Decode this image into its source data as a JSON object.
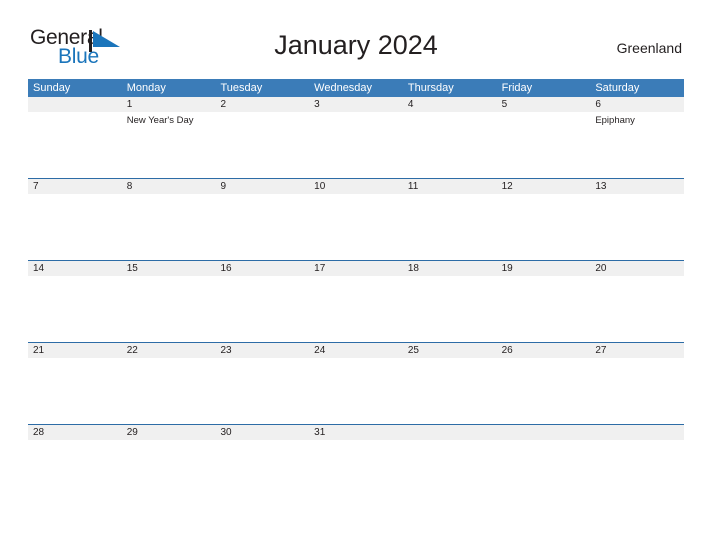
{
  "brand": {
    "name_part1": "General",
    "name_part2": "Blue",
    "mark_color": "#1b75bb",
    "text_color": "#231f20"
  },
  "header": {
    "title": "January 2024",
    "location": "Greenland"
  },
  "colors": {
    "header_blue": "#3b7cb8",
    "week_divider_blue": "#2d6ca6",
    "date_band_gray": "#f0f0f0",
    "text": "#231f20",
    "header_text": "#ffffff"
  },
  "calendar": {
    "month": "January",
    "year": "2024",
    "weekday_headers": [
      "Sunday",
      "Monday",
      "Tuesday",
      "Wednesday",
      "Thursday",
      "Friday",
      "Saturday"
    ],
    "weeks": [
      {
        "days": [
          {
            "date": "",
            "events": []
          },
          {
            "date": "1",
            "events": [
              "New Year's Day"
            ]
          },
          {
            "date": "2",
            "events": []
          },
          {
            "date": "3",
            "events": []
          },
          {
            "date": "4",
            "events": []
          },
          {
            "date": "5",
            "events": []
          },
          {
            "date": "6",
            "events": [
              "Epiphany"
            ]
          }
        ]
      },
      {
        "days": [
          {
            "date": "7",
            "events": []
          },
          {
            "date": "8",
            "events": []
          },
          {
            "date": "9",
            "events": []
          },
          {
            "date": "10",
            "events": []
          },
          {
            "date": "11",
            "events": []
          },
          {
            "date": "12",
            "events": []
          },
          {
            "date": "13",
            "events": []
          }
        ]
      },
      {
        "days": [
          {
            "date": "14",
            "events": []
          },
          {
            "date": "15",
            "events": []
          },
          {
            "date": "16",
            "events": []
          },
          {
            "date": "17",
            "events": []
          },
          {
            "date": "18",
            "events": []
          },
          {
            "date": "19",
            "events": []
          },
          {
            "date": "20",
            "events": []
          }
        ]
      },
      {
        "days": [
          {
            "date": "21",
            "events": []
          },
          {
            "date": "22",
            "events": []
          },
          {
            "date": "23",
            "events": []
          },
          {
            "date": "24",
            "events": []
          },
          {
            "date": "25",
            "events": []
          },
          {
            "date": "26",
            "events": []
          },
          {
            "date": "27",
            "events": []
          }
        ]
      },
      {
        "days": [
          {
            "date": "28",
            "events": []
          },
          {
            "date": "29",
            "events": []
          },
          {
            "date": "30",
            "events": []
          },
          {
            "date": "31",
            "events": []
          },
          {
            "date": "",
            "events": []
          },
          {
            "date": "",
            "events": []
          },
          {
            "date": "",
            "events": []
          }
        ]
      }
    ]
  }
}
